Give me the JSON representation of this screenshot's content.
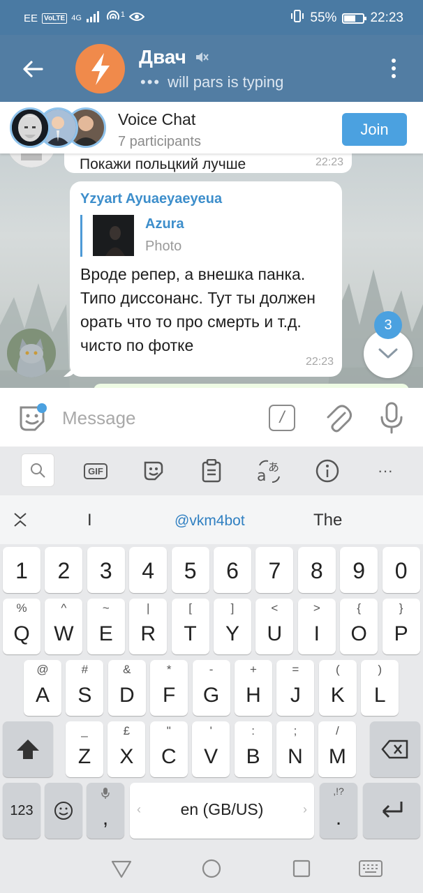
{
  "status_bar": {
    "carrier": "EE",
    "volte": "VoLTE",
    "network": "4G",
    "hotspot_count": "1",
    "battery_text": "55%",
    "battery_level": 0.55,
    "time": "22:23"
  },
  "header": {
    "title": "Двач",
    "typing_status": "will pars is typing",
    "icons": [
      "back-arrow-icon",
      "muted-speaker-icon",
      "more-vert-icon"
    ]
  },
  "voice_chat": {
    "title": "Voice Chat",
    "participants": "7 participants",
    "join_label": "Join"
  },
  "chat": {
    "previous_message": {
      "text": "Покажи польцкий лучше",
      "time": "22:23"
    },
    "message": {
      "author": "Yzyart Ayuaeyaeyeua",
      "reply_name": "Azura",
      "reply_type": "Photo",
      "text": "Вроде репер, а внешка панка. Типо диссонанс. Тут ты должен орать что то про смерть и т.д. чисто по фотке",
      "time": "22:23"
    },
    "unread_count": "3"
  },
  "input": {
    "placeholder": "Message",
    "command_symbol": "/"
  },
  "keyboard": {
    "toolbar": [
      "search-icon",
      "gif-icon",
      "sticker-icon",
      "clipboard-icon",
      "translate-icon",
      "info-icon",
      "more-icon"
    ],
    "gif_label": "GIF",
    "more_label": "···",
    "suggestions": [
      "I",
      "@vkm4bot",
      "The"
    ],
    "rows": {
      "numbers": [
        "1",
        "2",
        "3",
        "4",
        "5",
        "6",
        "7",
        "8",
        "9",
        "0"
      ],
      "row1": [
        {
          "main": "Q",
          "sec": "%"
        },
        {
          "main": "W",
          "sec": "^"
        },
        {
          "main": "E",
          "sec": "~"
        },
        {
          "main": "R",
          "sec": "|"
        },
        {
          "main": "T",
          "sec": "["
        },
        {
          "main": "Y",
          "sec": "]"
        },
        {
          "main": "U",
          "sec": "<"
        },
        {
          "main": "I",
          "sec": ">"
        },
        {
          "main": "O",
          "sec": "{"
        },
        {
          "main": "P",
          "sec": "}"
        }
      ],
      "row2": [
        {
          "main": "A",
          "sec": "@"
        },
        {
          "main": "S",
          "sec": "#"
        },
        {
          "main": "D",
          "sec": "&"
        },
        {
          "main": "F",
          "sec": "*"
        },
        {
          "main": "G",
          "sec": "-"
        },
        {
          "main": "H",
          "sec": "+"
        },
        {
          "main": "J",
          "sec": "="
        },
        {
          "main": "K",
          "sec": "("
        },
        {
          "main": "L",
          "sec": ")"
        }
      ],
      "row3": [
        {
          "main": "Z",
          "sec": "_"
        },
        {
          "main": "X",
          "sec": "£"
        },
        {
          "main": "C",
          "sec": "\""
        },
        {
          "main": "V",
          "sec": "'"
        },
        {
          "main": "B",
          "sec": ":"
        },
        {
          "main": "N",
          "sec": ";"
        },
        {
          "main": "M",
          "sec": "/"
        }
      ]
    },
    "bottom": {
      "num_label": "123",
      "comma": ",",
      "space_label": "en (GB/US)",
      "period": ".",
      "period_sec": ",!?"
    }
  },
  "nav": [
    "back-triangle-icon",
    "home-circle-icon",
    "recents-square-icon",
    "keyboard-switch-icon"
  ]
}
